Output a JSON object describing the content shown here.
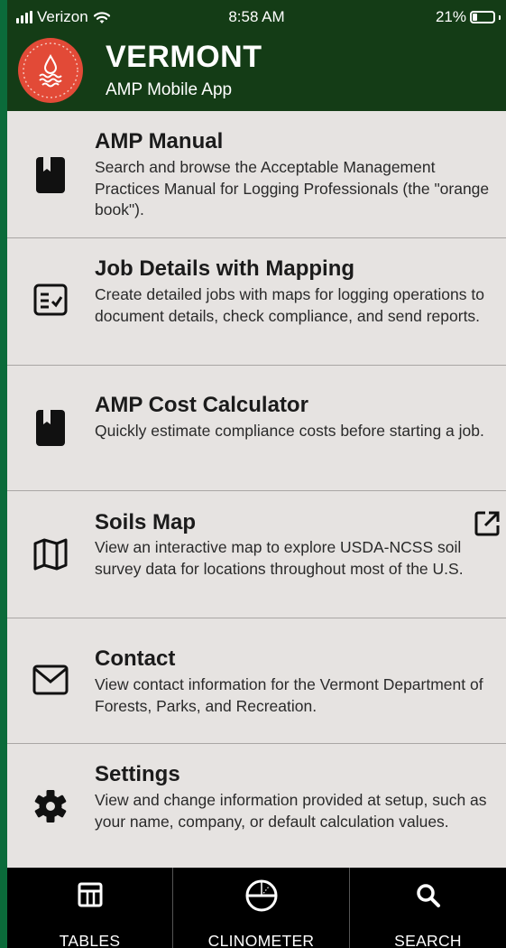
{
  "status_bar": {
    "carrier": "Verizon",
    "time": "8:58 AM",
    "battery": "21%",
    "battery_level": 0.21
  },
  "header": {
    "title": "VERMONT",
    "subtitle": "AMP Mobile App",
    "logo_icon": "water-drop-waves-icon",
    "colors": {
      "background": "#143c16",
      "logo": "#e24a37"
    }
  },
  "menu": {
    "items": [
      {
        "title": "AMP Manual",
        "description": "Search and browse the Acceptable Management Practices Manual for Logging Professionals (the \"orange book\").",
        "icon": "book-icon"
      },
      {
        "title": "Job Details with Mapping",
        "description": "Create detailed jobs with maps for logging operations to document details, check compliance, and send reports.",
        "icon": "checklist-icon"
      },
      {
        "title": "AMP Cost Calculator",
        "description": "Quickly estimate compliance costs before starting a job.",
        "icon": "book-icon"
      },
      {
        "title": "Soils Map",
        "description": "View an interactive map to explore USDA-NCSS soil survey data for locations throughout most of the U.S.",
        "icon": "map-icon",
        "external_icon": "external-link-icon"
      },
      {
        "title": "Contact",
        "description": "View contact information for the Vermont Department of Forests, Parks, and Recreation.",
        "icon": "mail-icon"
      },
      {
        "title": "Settings",
        "description": "View and change information provided at setup, such as your name, company, or default calculation values.",
        "icon": "gear-icon"
      }
    ]
  },
  "tabbar": {
    "tabs": [
      {
        "label": "TABLES",
        "icon": "table-icon"
      },
      {
        "label": "CLINOMETER",
        "icon": "clinometer-icon"
      },
      {
        "label": "SEARCH",
        "icon": "search-icon"
      }
    ]
  }
}
